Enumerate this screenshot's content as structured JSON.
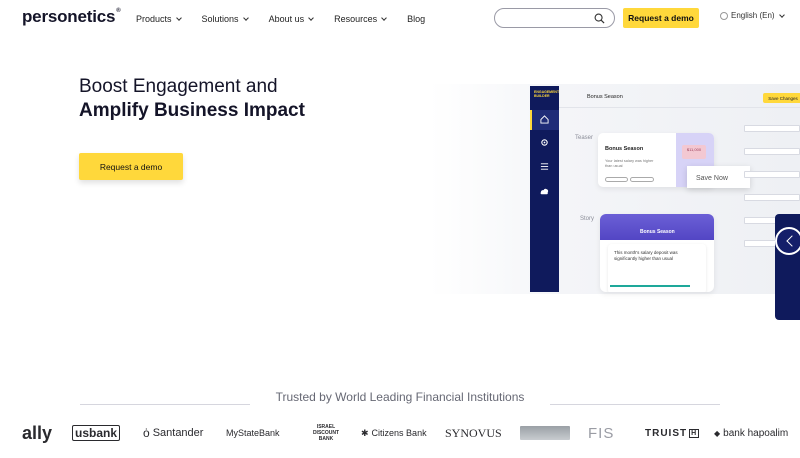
{
  "brand": {
    "logo_text": "personetics",
    "logo_mark": "®"
  },
  "nav": {
    "items": [
      {
        "label": "Products",
        "dropdown": true
      },
      {
        "label": "Solutions",
        "dropdown": true
      },
      {
        "label": "About us",
        "dropdown": true
      },
      {
        "label": "Resources",
        "dropdown": true
      },
      {
        "label": "Blog",
        "dropdown": false
      }
    ],
    "search": {
      "value": "",
      "placeholder": ""
    },
    "demo_label": "Request a demo",
    "language": "English (En)"
  },
  "hero": {
    "title_line1": "Boost Engagement and",
    "title_line2": "Amplify Business Impact",
    "cta_label": "Request a demo"
  },
  "mockup": {
    "brand": "ENGAGEMENT BUILDER",
    "page_title": "Bonus Season",
    "save_label": "Save Changes",
    "section_teaser": "Teaser",
    "section_story": "Story",
    "teaser_title": "Bonus Season",
    "teaser_text": "Your latest salary was higher than usual",
    "teaser_amount": "$11,000",
    "save_now": "Save Now",
    "story_title": "Bonus Season",
    "story_text": "This month's salary deposit was significantly higher than usual"
  },
  "trusted": {
    "title": "Trusted by World Leading Financial Institutions",
    "logos": [
      "ally",
      "usbank",
      "Santander",
      "MyStateBank",
      "ISRAEL DISCOUNT BANK",
      "Citizens Bank",
      "SYNOVUS",
      "FIS",
      "TRUIST",
      "bank hapoalim"
    ]
  },
  "colors": {
    "accent_yellow": "#ffd83b",
    "navy": "#0f1a5c",
    "text_dark": "#141428"
  }
}
